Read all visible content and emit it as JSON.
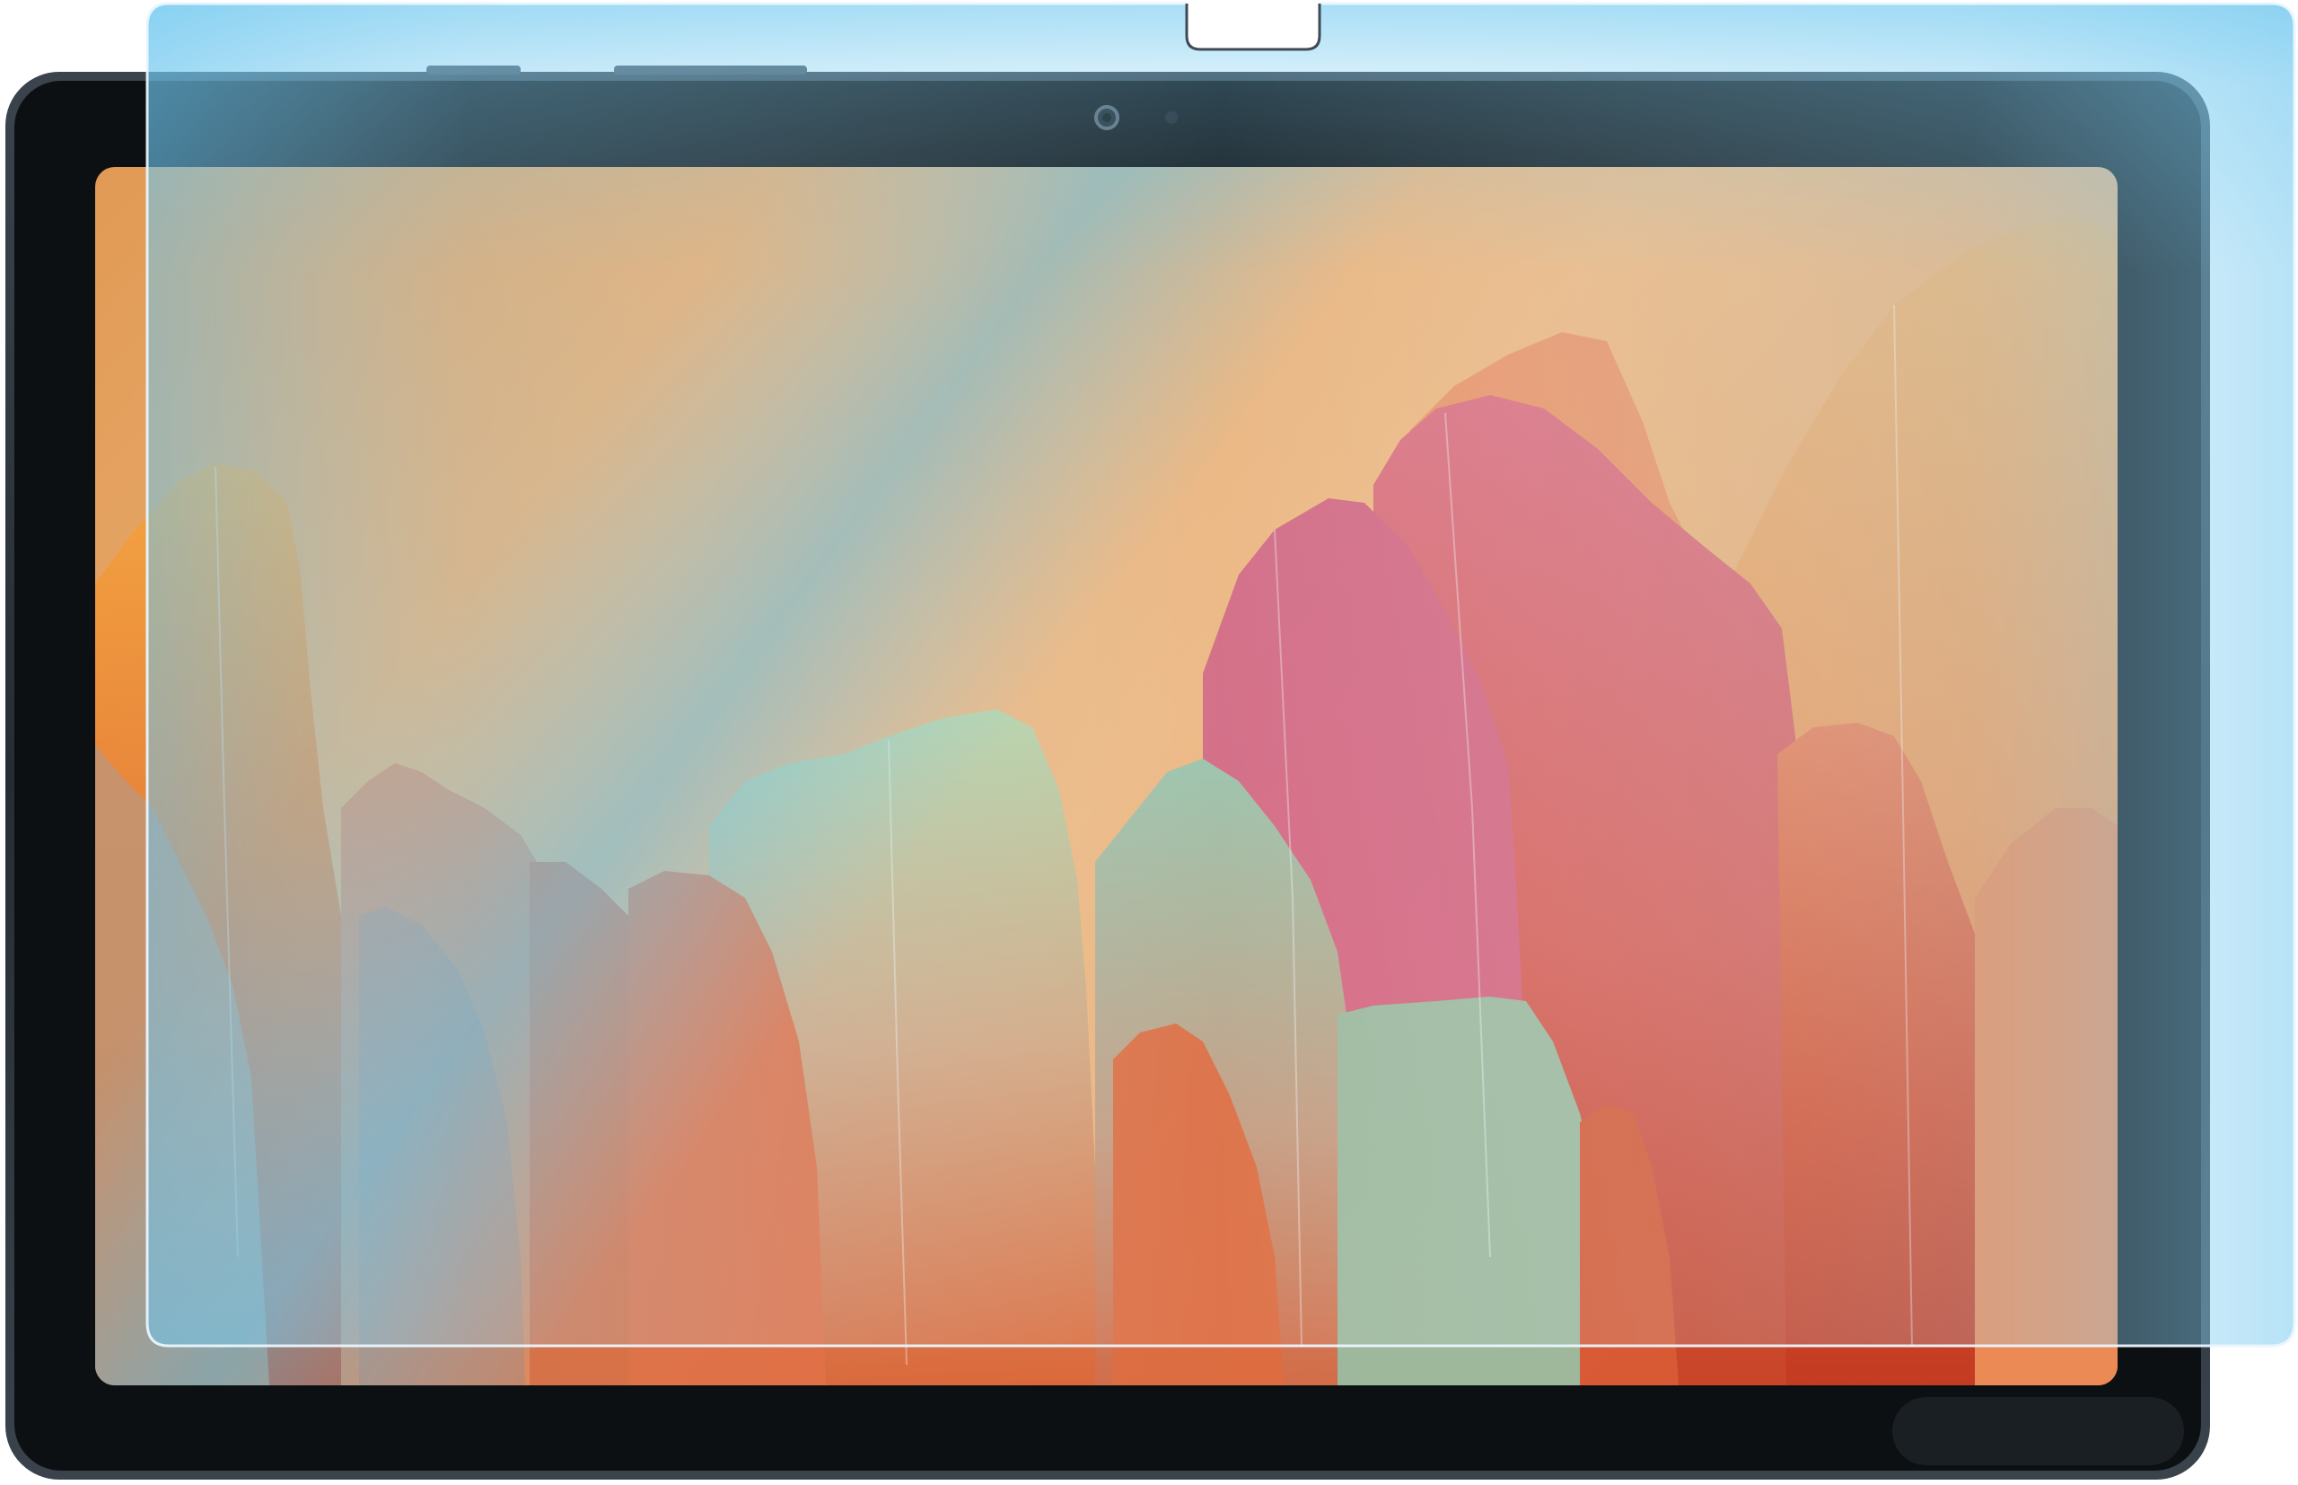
{
  "scene": {
    "subject": "tablet-with-screen-protector",
    "colors": {
      "background": "#ffffff",
      "tablet_body": "#2a3138",
      "tablet_bezel": "#0d1013",
      "camera": "#1c2229",
      "sky_top": "#e2a35f",
      "sky_mid": "#f3b57a",
      "protector_tint": "#6fc8ef",
      "protector_edge": "#e9f6fd",
      "rock_orange": "#f08a3c",
      "rock_red": "#d84a2a",
      "rock_pink": "#d86a78",
      "rock_green": "#a7c59a",
      "rock_teal": "#7fb0b3"
    },
    "icons": [
      "front-camera-icon",
      "light-sensor-icon"
    ]
  }
}
